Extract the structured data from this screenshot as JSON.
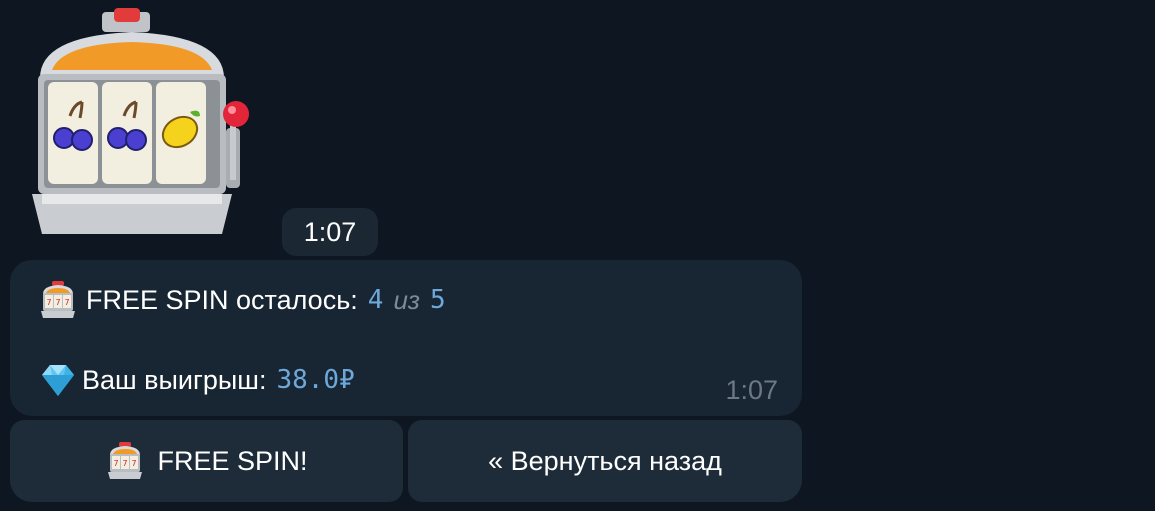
{
  "sticker": {
    "icon": "slot-machine-sticker",
    "reels": [
      "cherry",
      "cherry",
      "lemon"
    ]
  },
  "sticker_time": "1:07",
  "message": {
    "line1": {
      "icon": "slot-machine-icon",
      "label": "FREE SPIN осталось:",
      "current": "4",
      "of": "из",
      "total": "5"
    },
    "line2": {
      "icon": "gem-icon",
      "label": "Ваш выигрыш:",
      "amount": "38.0₽"
    },
    "time": "1:07"
  },
  "buttons": {
    "free_spin": {
      "icon": "slot-machine-icon",
      "label": "FREE SPIN!"
    },
    "back": {
      "label": "« Вернуться назад"
    }
  },
  "colors": {
    "background": "#0e1621",
    "bubble": "#182533",
    "button": "#1e2c3a",
    "mono": "#6ea8d9"
  }
}
